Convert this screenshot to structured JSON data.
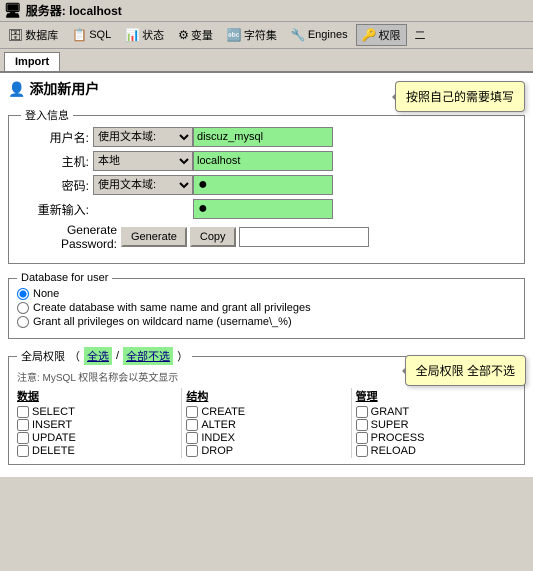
{
  "titlebar": {
    "label": "服务器: localhost"
  },
  "toolbar": {
    "items": [
      {
        "id": "db",
        "label": "数据库",
        "icon": "🗄"
      },
      {
        "id": "sql",
        "label": "SQL",
        "icon": "📋"
      },
      {
        "id": "status",
        "label": "状态",
        "icon": "📊"
      },
      {
        "id": "variables",
        "label": "变量",
        "icon": "⚙"
      },
      {
        "id": "charset",
        "label": "字符集",
        "icon": "🔤"
      },
      {
        "id": "engines",
        "label": "Engines",
        "icon": "🔧"
      },
      {
        "id": "privileges",
        "label": "权限",
        "icon": "🔑"
      },
      {
        "id": "more",
        "label": "二",
        "icon": ""
      }
    ]
  },
  "tabs": [
    {
      "id": "import",
      "label": "Import",
      "active": true
    }
  ],
  "page": {
    "title": "添加新用户",
    "tooltip1": "按照自己的需要填写"
  },
  "login_section": {
    "legend": "登入信息",
    "fields": [
      {
        "label": "用户名:",
        "select_value": "使用文本域:",
        "input_value": "discuz_mysql"
      },
      {
        "label": "主机:",
        "select_value": "本地",
        "input_value": "localhost"
      },
      {
        "label": "密码:",
        "select_value": "使用文本域:",
        "input_type": "password",
        "input_value": "●"
      },
      {
        "label": "重新输入:",
        "input_type": "password",
        "input_value": "●"
      }
    ],
    "generate_password": {
      "label": "Generate Password:",
      "generate_btn": "Generate",
      "copy_btn": "Copy",
      "input_value": ""
    }
  },
  "database_section": {
    "legend": "Database for user",
    "options": [
      {
        "id": "none",
        "label": "None",
        "checked": true
      },
      {
        "id": "create_same",
        "label": "Create database with same name and grant all privileges",
        "checked": false
      },
      {
        "id": "wildcard",
        "label": "Grant all privileges on wildcard name (username\\_%)"
      },
      {
        "checked": false
      }
    ]
  },
  "privileges_section": {
    "legend": "全局权限",
    "select_all": "全选",
    "select_none": "全部不选",
    "tooltip2": "全局权限 全部不选",
    "note": "注意: MySQL 权限名称会以英文显示",
    "columns": [
      {
        "title": "数据",
        "items": [
          "SELECT",
          "INSERT",
          "UPDATE",
          "DELETE"
        ]
      },
      {
        "title": "结构",
        "items": [
          "CREATE",
          "ALTER",
          "INDEX",
          "DROP"
        ]
      },
      {
        "title": "管理",
        "items": [
          "GRANT",
          "SUPER",
          "PROCESS",
          "RELOAD"
        ]
      }
    ]
  }
}
